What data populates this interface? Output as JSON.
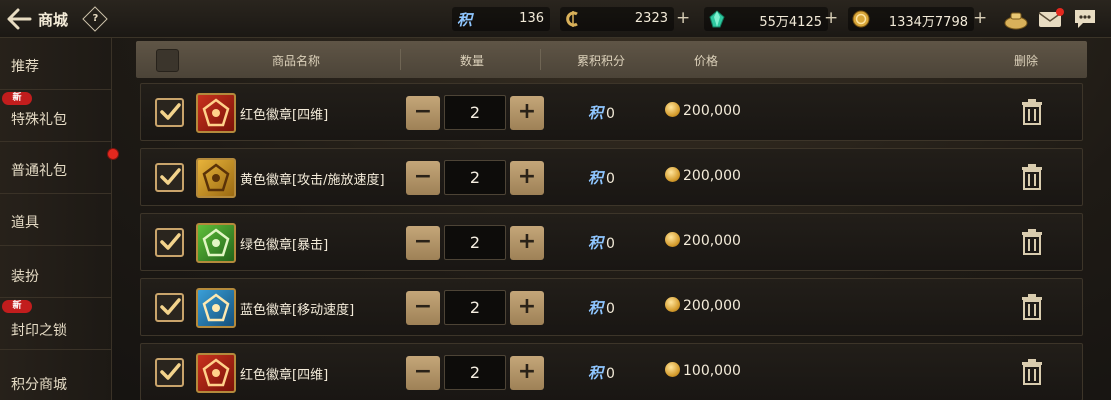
{
  "header": {
    "title": "商城",
    "help_label": "?",
    "currencies": [
      {
        "icon": "jifen-icon",
        "glyph": "积",
        "value": "136"
      },
      {
        "icon": "c-coin-icon",
        "value": "2323"
      },
      {
        "icon": "green-crystal-icon",
        "value": "55万4125"
      },
      {
        "icon": "gold-coin-icon",
        "value": "1334万7798"
      }
    ],
    "plus_label": "+"
  },
  "sidebar": {
    "new_badge": "新",
    "items": [
      {
        "label": "推荐"
      },
      {
        "label": "特殊礼包"
      },
      {
        "label": "普通礼包"
      },
      {
        "label": "道具"
      },
      {
        "label": "装扮"
      },
      {
        "label": "封印之锁"
      },
      {
        "label": "积分商城"
      }
    ]
  },
  "table": {
    "columns": [
      "商品名称",
      "数量",
      "累积积分",
      "价格",
      "删除"
    ],
    "minus_label": "−",
    "plus_label": "+",
    "jifen_glyph": "积",
    "rows": [
      {
        "name": "红色徽章[四维]",
        "qty": "2",
        "points": "0",
        "price": "200,000",
        "icon_color": "red",
        "checked": true
      },
      {
        "name": "黄色徽章[攻击/施放速度]",
        "qty": "2",
        "points": "0",
        "price": "200,000",
        "icon_color": "yellow",
        "checked": true
      },
      {
        "name": "绿色徽章[暴击]",
        "qty": "2",
        "points": "0",
        "price": "200,000",
        "icon_color": "green",
        "checked": true
      },
      {
        "name": "蓝色徽章[移动速度]",
        "qty": "2",
        "points": "0",
        "price": "200,000",
        "icon_color": "blue",
        "checked": true
      },
      {
        "name": "红色徽章[四维]",
        "qty": "2",
        "points": "0",
        "price": "100,000",
        "icon_color": "red",
        "checked": true
      }
    ]
  },
  "colors": {
    "accent_gold": "#c9a46b",
    "red_badge": "#c21d1d"
  }
}
